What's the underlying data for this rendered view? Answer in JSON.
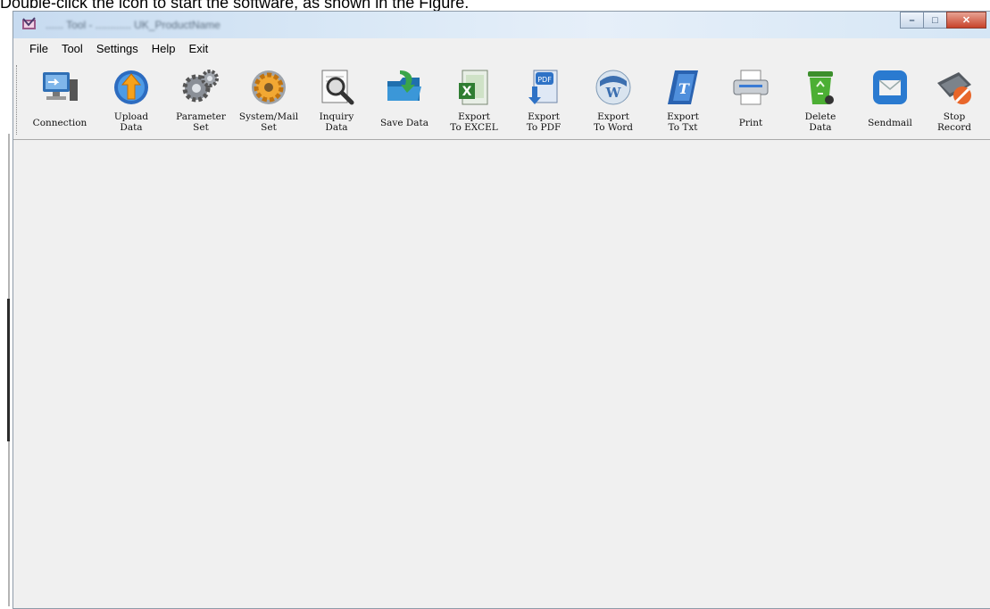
{
  "caption": "Double-click the icon to start the software, as shown in the Figure.",
  "window": {
    "title": "...... Tool - ............ UK_ProductName",
    "controls": {
      "minimize": "–",
      "maximize": "□",
      "close": "✕"
    }
  },
  "menu": [
    "File",
    "Tool",
    "Settings",
    "Help",
    "Exit"
  ],
  "toolbar": [
    {
      "label": "Connection",
      "icon": "computer-network-icon"
    },
    {
      "label": "Upload\nData",
      "icon": "upload-globe-icon"
    },
    {
      "label": "Parameter\nSet",
      "icon": "gears-icon"
    },
    {
      "label": "System/Mail\nSet",
      "icon": "gear-icon"
    },
    {
      "label": "Inquiry\nData",
      "icon": "magnifier-icon"
    },
    {
      "label": "Save Data",
      "icon": "folder-save-icon"
    },
    {
      "label": "Export\nTo EXCEL",
      "icon": "excel-icon"
    },
    {
      "label": "Export\nTo PDF",
      "icon": "pdf-icon"
    },
    {
      "label": "Export\nTo Word",
      "icon": "word-icon"
    },
    {
      "label": "Export\nTo Txt",
      "icon": "txt-icon"
    },
    {
      "label": "Print",
      "icon": "printer-icon"
    },
    {
      "label": "Delete\nData",
      "icon": "trash-icon"
    },
    {
      "label": "Sendmail",
      "icon": "mail-icon"
    },
    {
      "label": "Stop\nRecord",
      "icon": "stop-device-icon"
    }
  ],
  "colors": {
    "window_bg": "#f0f0f0",
    "titlebar": "#d9e8f6",
    "close_button": "#c7432a"
  }
}
